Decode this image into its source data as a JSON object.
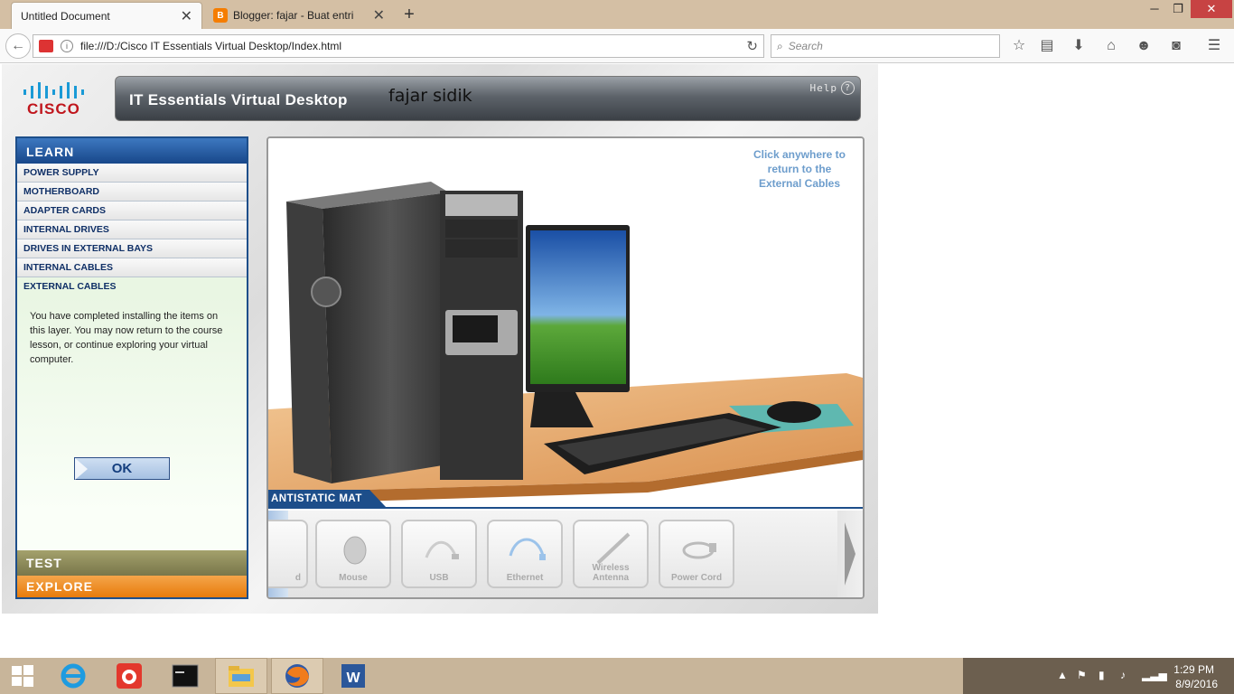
{
  "browser": {
    "tabs": [
      {
        "label": "Untitled Document",
        "active": true
      },
      {
        "label": "Blogger: fajar - Buat entri",
        "active": false
      }
    ],
    "url": "file:///D:/Cisco IT Essentials Virtual Desktop/Index.html",
    "search_placeholder": "Search"
  },
  "app": {
    "logo_text": "CISCO",
    "title": "IT Essentials Virtual Desktop",
    "user_name": "fajar sidik",
    "help_label": "Help",
    "help_glyph": "?",
    "learn_label": "LEARN",
    "menu": [
      "POWER SUPPLY",
      "MOTHERBOARD",
      "ADAPTER CARDS",
      "INTERNAL DRIVES",
      "DRIVES IN EXTERNAL BAYS",
      "INTERNAL CABLES",
      "EXTERNAL CABLES"
    ],
    "active_menu": "EXTERNAL CABLES",
    "message": "You have completed installing the items on this layer. You may now return to the course lesson, or continue exploring your virtual computer.",
    "ok_label": "OK",
    "test_label": "TEST",
    "explore_label": "EXPLORE",
    "click_hint": "Click anywhere to return to the External Cables",
    "layer_label": "ANTISTATIC MAT",
    "tray_items": [
      "d",
      "Mouse",
      "USB",
      "Ethernet",
      "Wireless Antenna",
      "Power Cord"
    ],
    "colors": {
      "learn": "#1d4e8a",
      "test": "#8f8c5b",
      "explore": "#ee8a1e",
      "cisco_red": "#c0161d",
      "hint": "#6d9dcc"
    }
  },
  "taskbar": {
    "time": "1:29 PM",
    "date": "8/9/2016",
    "apps": [
      "internet-explorer-icon",
      "pinned-app-icon",
      "command-prompt-icon",
      "file-explorer-icon",
      "firefox-icon",
      "word-icon"
    ]
  }
}
